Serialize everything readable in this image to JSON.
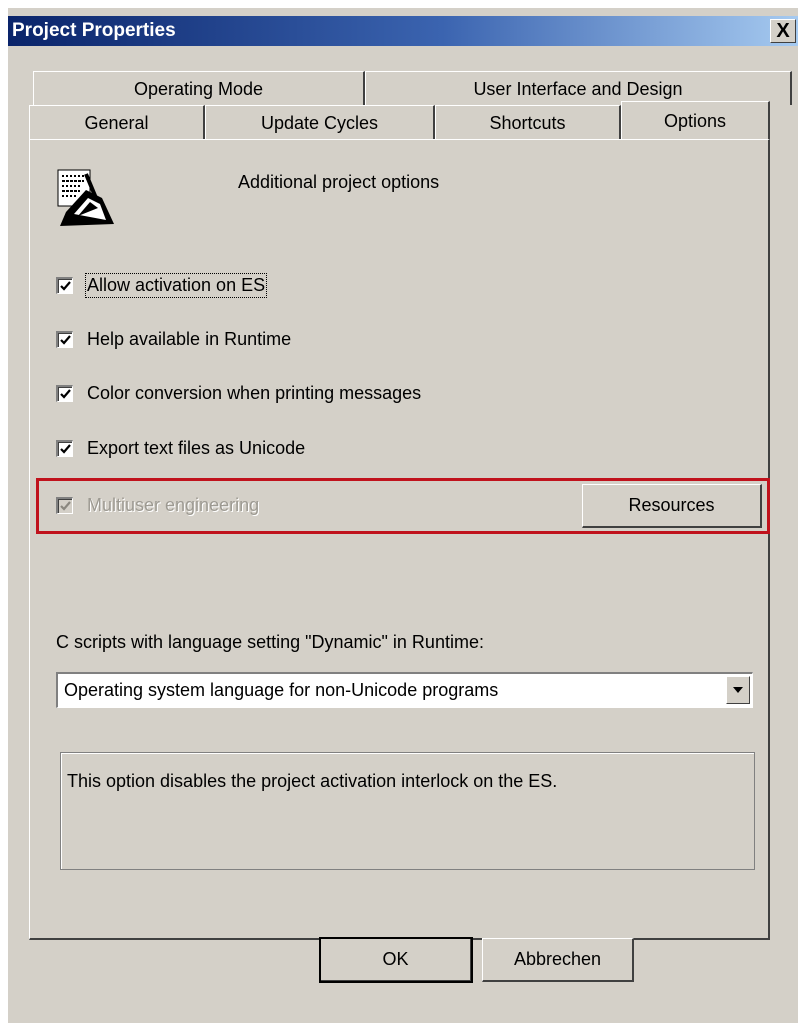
{
  "window": {
    "title": "Project Properties",
    "close_label": "X"
  },
  "tabs": {
    "row1": [
      {
        "label": "Operating Mode"
      },
      {
        "label": "User Interface and Design"
      }
    ],
    "row2": [
      {
        "label": "General"
      },
      {
        "label": "Update Cycles"
      },
      {
        "label": "Shortcuts"
      },
      {
        "label": "Options",
        "active": true
      }
    ]
  },
  "options": {
    "heading": "Additional project options",
    "icon": "project-options-icon",
    "checkboxes": [
      {
        "label": "Allow activation on ES",
        "checked": true,
        "enabled": true
      },
      {
        "label": "Help available in Runtime",
        "checked": true,
        "enabled": true
      },
      {
        "label": "Color conversion when printing messages",
        "checked": true,
        "enabled": true
      },
      {
        "label": "Export text files as Unicode",
        "checked": true,
        "enabled": true
      },
      {
        "label": "Multiuser engineering",
        "checked": true,
        "enabled": false
      }
    ],
    "resources_button": "Resources",
    "c_scripts_label": "C scripts with language setting \"Dynamic\" in Runtime:",
    "language_select": {
      "value": "Operating system language for non-Unicode programs"
    },
    "description": "This option disables the project activation interlock on the ES."
  },
  "footer": {
    "ok": "OK",
    "cancel": "Abbrechen"
  },
  "colors": {
    "highlight": "#c0121c",
    "title_start": "#0a246a",
    "title_end": "#a6caf0",
    "face": "#d4d0c8"
  }
}
